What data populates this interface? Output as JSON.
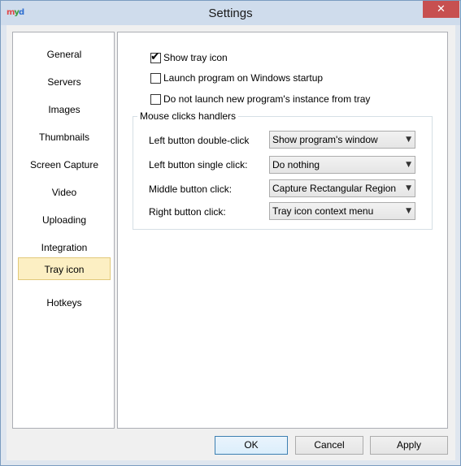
{
  "window": {
    "title": "Settings",
    "close_glyph": "✕",
    "icon_text": [
      "m",
      "y",
      "d"
    ]
  },
  "sidebar": {
    "items": [
      {
        "label": "General"
      },
      {
        "label": "Servers"
      },
      {
        "label": "Images"
      },
      {
        "label": "Thumbnails"
      },
      {
        "label": "Screen Capture"
      },
      {
        "label": "Video"
      },
      {
        "label": "Uploading"
      },
      {
        "label": "Integration"
      },
      {
        "label": "Tray icon",
        "selected": true
      },
      {
        "label": "Hotkeys"
      }
    ]
  },
  "options": {
    "show_tray_icon": {
      "label": "Show tray icon",
      "checked": true
    },
    "launch_on_startup": {
      "label": "Launch program on Windows startup",
      "checked": false
    },
    "no_new_instance": {
      "label": "Do not launch new program's instance from tray",
      "checked": false
    }
  },
  "mouse_group": {
    "legend": "Mouse clicks handlers",
    "rows": [
      {
        "label": "Left button double-click",
        "value": "Show program's window"
      },
      {
        "label": "Left button single click:",
        "value": "Do nothing"
      },
      {
        "label": "Middle button click:",
        "value": "Capture Rectangular Region"
      },
      {
        "label": "Right button click:",
        "value": "Tray icon context menu"
      }
    ]
  },
  "buttons": {
    "ok": "OK",
    "cancel": "Cancel",
    "apply": "Apply"
  },
  "glyphs": {
    "check": "✔",
    "dropdown_arrow": "▼"
  },
  "colors": {
    "selected_bg": "#fcefc3",
    "close_red": "#c75050",
    "title_bar": "#cfdcec"
  }
}
